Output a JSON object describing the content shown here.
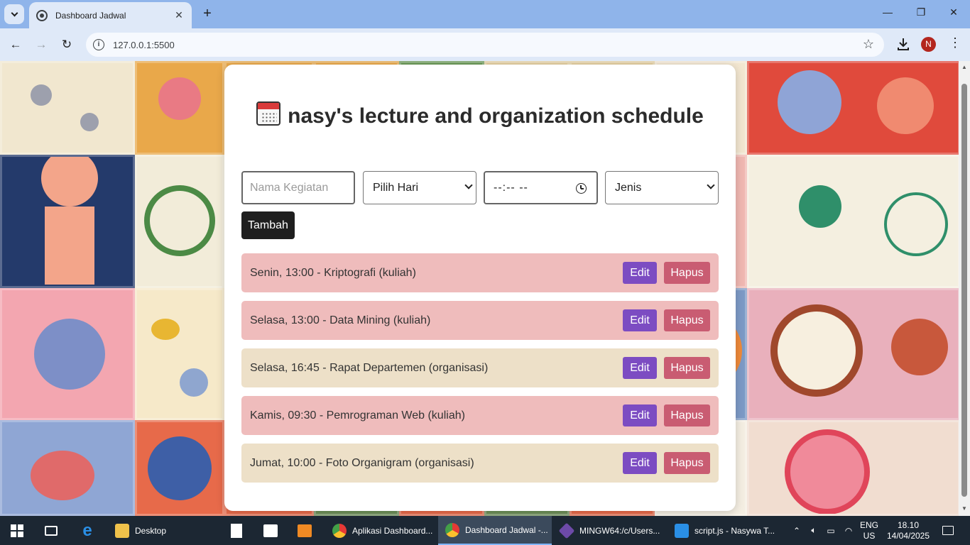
{
  "browser": {
    "tab_title": "Dashboard Jadwal",
    "url": "127.0.0.1:5500",
    "profile_initial": "N"
  },
  "app": {
    "title": "nasy's lecture and organization schedule",
    "title_icon": "calendar-icon",
    "form": {
      "name_placeholder": "Nama Kegiatan",
      "day_select": "Pilih Hari",
      "time_value": "--:-- --",
      "type_select": "Jenis",
      "add_label": "Tambah"
    },
    "schedule": [
      {
        "text": "Senin, 13:00 - Kriptografi (kuliah)",
        "category": "kuliah",
        "color": "#efbcbc"
      },
      {
        "text": "Selasa, 13:00 - Data Mining (kuliah)",
        "category": "kuliah",
        "color": "#efbcbc"
      },
      {
        "text": "Selasa, 16:45 - Rapat Departemen (organisasi)",
        "category": "organisasi",
        "color": "#ede0c8"
      },
      {
        "text": "Kamis, 09:30 - Pemrograman Web (kuliah)",
        "category": "kuliah",
        "color": "#efbcbc"
      },
      {
        "text": "Jumat, 10:00 - Foto Organigram (organisasi)",
        "category": "organisasi",
        "color": "#ede0c8"
      }
    ],
    "edit_label": "Edit",
    "delete_label": "Hapus",
    "colors": {
      "edit": "#7c4cc2",
      "delete": "#c95c72",
      "add": "#1f1f1f"
    }
  },
  "taskbar": {
    "items": [
      {
        "label": "Desktop"
      },
      {
        "label": "Aplikasi Dashboard..."
      },
      {
        "label": "Dashboard Jadwal -..."
      },
      {
        "label": "MINGW64:/c/Users..."
      },
      {
        "label": "script.js - Nasywa T..."
      }
    ],
    "lang_top": "ENG",
    "lang_bottom": "US",
    "time": "18.10",
    "date": "14/04/2025"
  }
}
